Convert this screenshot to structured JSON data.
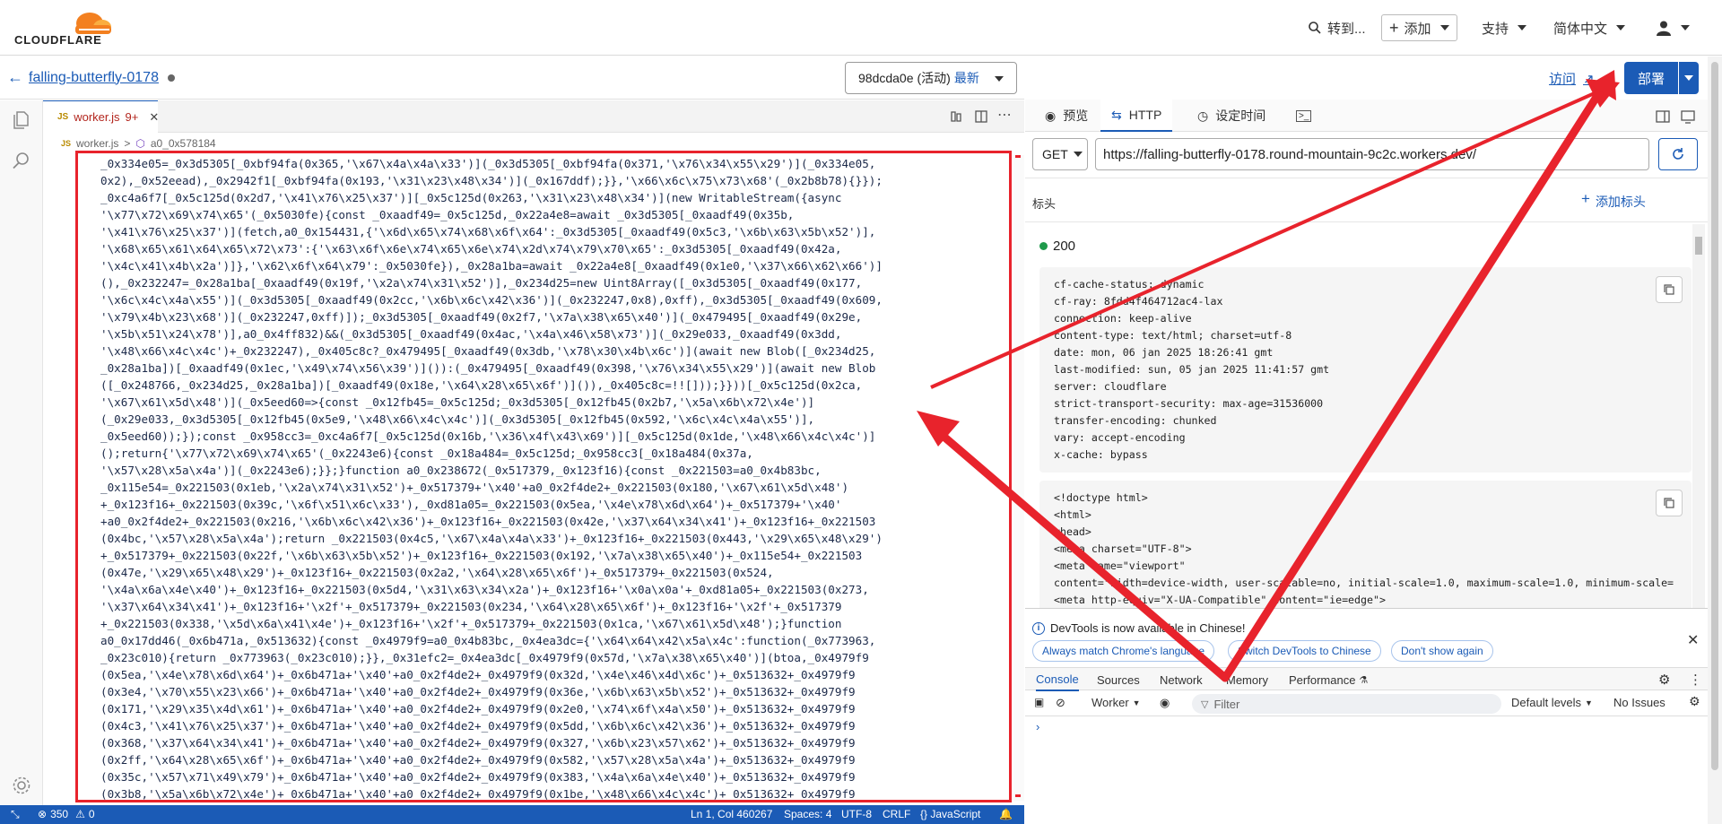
{
  "header": {
    "brand": "CLOUDFLARE",
    "goto_label": "转到...",
    "add_label": "添加",
    "support_label": "支持",
    "language_label": "简体中文"
  },
  "editor": {
    "worker_name": "falling-butterfly-0178",
    "version_id": "98dcda0e",
    "version_status": "(活动)",
    "version_latest": "最新",
    "tab_prefix": "JS",
    "tab_filename": "worker.js",
    "tab_badge": "9+",
    "path_file": "worker.js",
    "path_separator": ">",
    "path_symbol": "a0_0x578184",
    "code_lines": [
      "_0x334e05=_0x3d5305[_0xbf94fa(0x365,'\\x67\\x4a\\x4a\\x33')](_0x3d5305[_0xbf94fa(0x371,'\\x76\\x34\\x55\\x29')](_0x334e05,",
      "0x2),_0x52eead),_0x2942f1[_0xbf94fa(0x193,'\\x31\\x23\\x48\\x34')](_0x167ddf);}},'\\x66\\x6c\\x75\\x73\\x68'(_0x2b8b78){}});",
      "_0xc4a6f7[_0x5c125d(0x2d7,'\\x41\\x76\\x25\\x37')][_0x5c125d(0x263,'\\x31\\x23\\x48\\x34')](new WritableStream({async",
      "'\\x77\\x72\\x69\\x74\\x65'(_0x5030fe){const _0xaadf49=_0x5c125d,_0x22a4e8=await _0x3d5305[_0xaadf49(0x35b,",
      "'\\x41\\x76\\x25\\x37')](fetch,a0_0x154431,{'\\x6d\\x65\\x74\\x68\\x6f\\x64':_0x3d5305[_0xaadf49(0x5c3,'\\x6b\\x63\\x5b\\x52')],",
      "'\\x68\\x65\\x61\\x64\\x65\\x72\\x73':{'\\x63\\x6f\\x6e\\x74\\x65\\x6e\\x74\\x2d\\x74\\x79\\x70\\x65':_0x3d5305[_0xaadf49(0x42a,",
      "'\\x4c\\x41\\x4b\\x2a')]},'\\x62\\x6f\\x64\\x79':_0x5030fe}),_0x28a1ba=await _0x22a4e8[_0xaadf49(0x1e0,'\\x37\\x66\\x62\\x66')]",
      "(),_0x232247=_0x28a1ba[_0xaadf49(0x19f,'\\x2a\\x74\\x31\\x52')],_0x234d25=new Uint8Array([_0x3d5305[_0xaadf49(0x177,",
      "'\\x6c\\x4c\\x4a\\x55')](_0x3d5305[_0xaadf49(0x2cc,'\\x6b\\x6c\\x42\\x36')](_0x232247,0x8),0xff),_0x3d5305[_0xaadf49(0x609,",
      "'\\x79\\x4b\\x23\\x68')](_0x232247,0xff)]);_0x3d5305[_0xaadf49(0x2f7,'\\x7a\\x38\\x65\\x40')](_0x479495[_0xaadf49(0x29e,",
      "'\\x5b\\x51\\x24\\x78')],a0_0x4ff832)&&(_0x3d5305[_0xaadf49(0x4ac,'\\x4a\\x46\\x58\\x73')](_0x29e033,_0xaadf49(0x3dd,",
      "'\\x48\\x66\\x4c\\x4c')+_0x232247),_0x405c8c?_0x479495[_0xaadf49(0x3db,'\\x78\\x30\\x4b\\x6c')](await new Blob([_0x234d25,",
      "_0x28a1ba])[_0xaadf49(0x1ec,'\\x49\\x74\\x56\\x39')]()):(_0x479495[_0xaadf49(0x398,'\\x76\\x34\\x55\\x29')](await new Blob",
      "([_0x248766,_0x234d25,_0x28a1ba])[_0xaadf49(0x18e,'\\x64\\x28\\x65\\x6f')]()),_0x405c8c=!![]));}}))[_0x5c125d(0x2ca,",
      "'\\x67\\x61\\x5d\\x48')](_0x5eed60=>{const _0x12fb45=_0x5c125d;_0x3d5305[_0x12fb45(0x2b7,'\\x5a\\x6b\\x72\\x4e')]",
      "(_0x29e033,_0x3d5305[_0x12fb45(0x5e9,'\\x48\\x66\\x4c\\x4c')](_0x3d5305[_0x12fb45(0x592,'\\x6c\\x4c\\x4a\\x55')],",
      "_0x5eed60));});const _0x958cc3=_0xc4a6f7[_0x5c125d(0x16b,'\\x36\\x4f\\x43\\x69')][_0x5c125d(0x1de,'\\x48\\x66\\x4c\\x4c')]",
      "();return{'\\x77\\x72\\x69\\x74\\x65'(_0x2243e6){const _0x18a484=_0x5c125d;_0x958cc3[_0x18a484(0x37a,",
      "'\\x57\\x28\\x5a\\x4a')](_0x2243e6);}};}function a0_0x238672(_0x517379,_0x123f16){const _0x221503=a0_0x4b83bc,",
      "_0x115e54=_0x221503(0x1eb,'\\x2a\\x74\\x31\\x52')+_0x517379+'\\x40'+a0_0x2f4de2+_0x221503(0x180,'\\x67\\x61\\x5d\\x48')",
      "+_0x123f16+_0x221503(0x39c,'\\x6f\\x51\\x6c\\x33'),_0xd81a05=_0x221503(0x5ea,'\\x4e\\x78\\x6d\\x64')+_0x517379+'\\x40'",
      "+a0_0x2f4de2+_0x221503(0x216,'\\x6b\\x6c\\x42\\x36')+_0x123f16+_0x221503(0x42e,'\\x37\\x64\\x34\\x41')+_0x123f16+_0x221503",
      "(0x4bc,'\\x57\\x28\\x5a\\x4a');return _0x221503(0x4c5,'\\x67\\x4a\\x4a\\x33')+_0x123f16+_0x221503(0x443,'\\x29\\x65\\x48\\x29')",
      "+_0x517379+_0x221503(0x22f,'\\x6b\\x63\\x5b\\x52')+_0x123f16+_0x221503(0x192,'\\x7a\\x38\\x65\\x40')+_0x115e54+_0x221503",
      "(0x47e,'\\x29\\x65\\x48\\x29')+_0x123f16+_0x221503(0x2a2,'\\x64\\x28\\x65\\x6f')+_0x517379+_0x221503(0x524,",
      "'\\x4a\\x6a\\x4e\\x40')+_0x123f16+_0x221503(0x5d4,'\\x31\\x63\\x34\\x2a')+_0x123f16+'\\x0a\\x0a'+_0xd81a05+_0x221503(0x273,",
      "'\\x37\\x64\\x34\\x41')+_0x123f16+'\\x2f'+_0x517379+_0x221503(0x234,'\\x64\\x28\\x65\\x6f')+_0x123f16+'\\x2f'+_0x517379",
      "+_0x221503(0x338,'\\x5d\\x6a\\x41\\x4e')+_0x123f16+'\\x2f'+_0x517379+_0x221503(0x1ca,'\\x67\\x61\\x5d\\x48');}function",
      "a0_0x17dd46(_0x6b471a,_0x513632){const _0x4979f9=a0_0x4b83bc,_0x4ea3dc={'\\x64\\x64\\x42\\x5a\\x4c':function(_0x773963,",
      "_0x23c010){return _0x773963(_0x23c010);}},_0x31efc2=_0x4ea3dc[_0x4979f9(0x57d,'\\x7a\\x38\\x65\\x40')](btoa,_0x4979f9",
      "(0x5ea,'\\x4e\\x78\\x6d\\x64')+_0x6b471a+'\\x40'+a0_0x2f4de2+_0x4979f9(0x32d,'\\x4e\\x46\\x4d\\x6c')+_0x513632+_0x4979f9",
      "(0x3e4,'\\x70\\x55\\x23\\x66')+_0x6b471a+'\\x40'+a0_0x2f4de2+_0x4979f9(0x36e,'\\x6b\\x63\\x5b\\x52')+_0x513632+_0x4979f9",
      "(0x171,'\\x29\\x35\\x4d\\x61')+_0x6b471a+'\\x40'+a0_0x2f4de2+_0x4979f9(0x2e0,'\\x74\\x6f\\x4a\\x50')+_0x513632+_0x4979f9",
      "(0x4c3,'\\x41\\x76\\x25\\x37')+_0x6b471a+'\\x40'+a0_0x2f4de2+_0x4979f9(0x5dd,'\\x6b\\x6c\\x42\\x36')+_0x513632+_0x4979f9",
      "(0x368,'\\x37\\x64\\x34\\x41')+_0x6b471a+'\\x40'+a0_0x2f4de2+_0x4979f9(0x327,'\\x6b\\x23\\x57\\x62')+_0x513632+_0x4979f9",
      "(0x2ff,'\\x64\\x28\\x65\\x6f')+_0x6b471a+'\\x40'+a0_0x2f4de2+_0x4979f9(0x582,'\\x57\\x28\\x5a\\x4a')+_0x513632+_0x4979f9",
      "(0x35c,'\\x57\\x71\\x49\\x79')+_0x6b471a+'\\x40'+a0_0x2f4de2+_0x4979f9(0x383,'\\x4a\\x6a\\x4e\\x40')+_0x513632+_0x4979f9",
      "(0x3b8,'\\x5a\\x6b\\x72\\x4e')+_0x6b471a+'\\x40'+a0_0x2f4de2+_0x4979f9(0x1be,'\\x48\\x66\\x4c\\x4c')+_0x513632+_0x4979f9"
    ]
  },
  "statusbar": {
    "errors": "350",
    "warnings": "0",
    "position": "Ln 1, Col 460267",
    "indent": "Spaces: 4",
    "encoding": "UTF-8",
    "eol": "CRLF",
    "language": "{} JavaScript"
  },
  "right": {
    "visit_label": "访问",
    "deploy_label": "部署",
    "tabs": {
      "preview": "预览",
      "http": "HTTP",
      "schedule": "设定时间"
    },
    "method": "GET",
    "url": "https://falling-butterfly-0178.round-mountain-9c2c.workers.dev/",
    "headers_label": "标头",
    "add_header_label": "添加标头",
    "status_code": "200",
    "response_headers": [
      "cf-cache-status: dynamic",
      "cf-ray: 8fdd4f464712ac4-lax",
      "connection: keep-alive",
      "content-type: text/html; charset=utf-8",
      "date: mon, 06 jan 2025 18:26:41 gmt",
      "last-modified: sun, 05 jan 2025 11:41:57 gmt",
      "server: cloudflare",
      "strict-transport-security: max-age=31536000",
      "transfer-encoding: chunked",
      "vary: accept-encoding",
      "x-cache: bypass"
    ],
    "response_body": [
      "<!doctype html>",
      "<html>",
      "<head>",
      "<meta charset=\"UTF-8\">",
      "<meta name=\"viewport\"",
      "content=\"width=device-width, user-scalable=no, initial-scale=1.0, maximum-scale=1.0, minimum-scale=",
      "<meta http-equiv=\"X-UA-Compatible\" content=\"ie=edge\">"
    ]
  },
  "devtools": {
    "notice": "DevTools is now available in Chinese!",
    "btn_match": "Always match Chrome's language",
    "btn_switch": "Switch DevTools to Chinese",
    "btn_dont_show": "Don't show again",
    "tabs": [
      "Console",
      "Sources",
      "Network",
      "Memory",
      "Performance"
    ],
    "context": "Worker",
    "filter_placeholder": "Filter",
    "levels": "Default levels",
    "issues": "No Issues",
    "prompt": "›"
  },
  "colors": {
    "accent": "#1b5bb6",
    "annotation": "#e8232c",
    "brand_orange": "#f38020"
  }
}
